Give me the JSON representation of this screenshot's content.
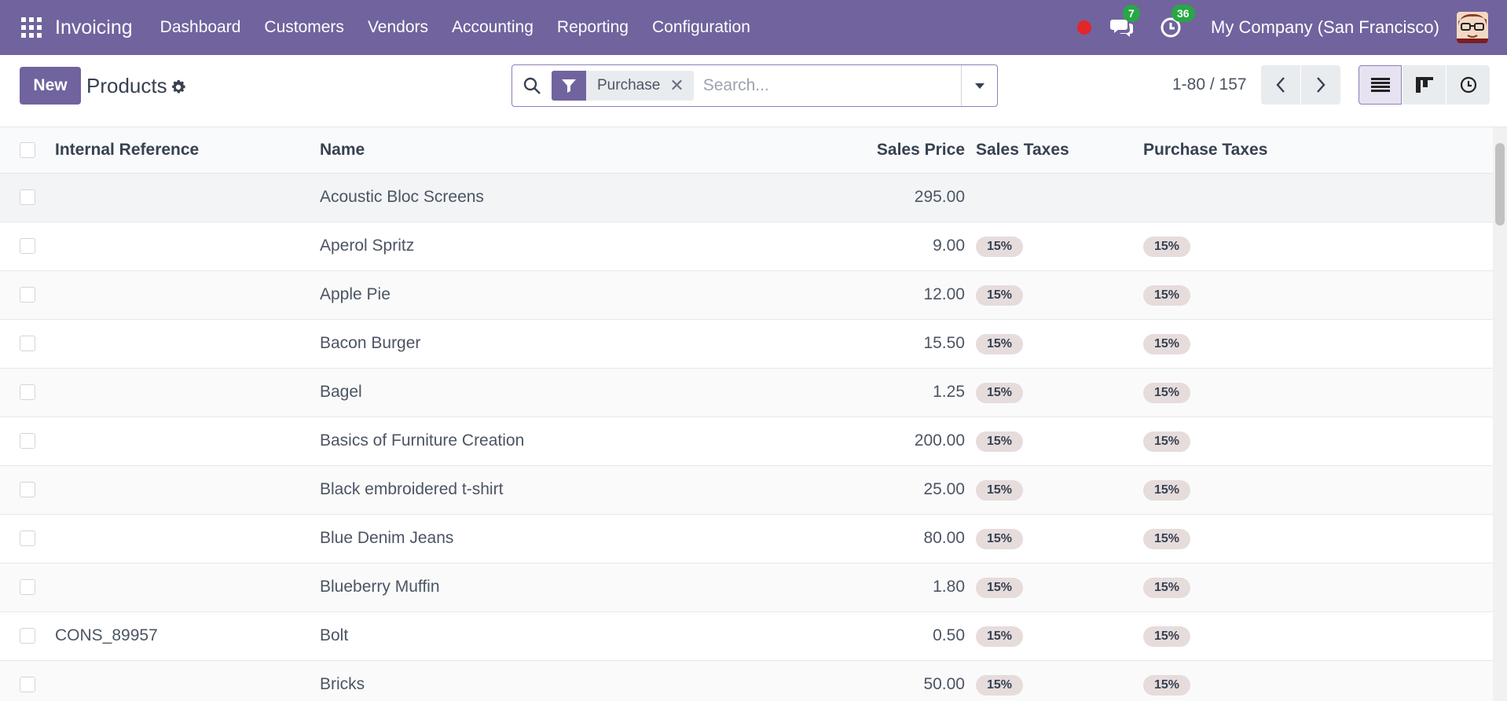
{
  "navbar": {
    "app_name": "Invoicing",
    "menu": [
      "Dashboard",
      "Customers",
      "Vendors",
      "Accounting",
      "Reporting",
      "Configuration"
    ],
    "messages_count": "7",
    "activities_count": "36",
    "company": "My Company (San Francisco)",
    "accent_color": "#71639e"
  },
  "control": {
    "new_label": "New",
    "title": "Products",
    "facet_label": "Purchase",
    "facet_remove": "✕",
    "search_placeholder": "Search...",
    "pager": "1-80 / 157"
  },
  "table": {
    "headers": {
      "ref": "Internal Reference",
      "name": "Name",
      "price": "Sales Price",
      "sales_taxes": "Sales Taxes",
      "purchase_taxes": "Purchase Taxes"
    },
    "rows": [
      {
        "ref": "",
        "name": "Acoustic Bloc Screens",
        "price": "295.00",
        "sales_tax": "",
        "purchase_tax": ""
      },
      {
        "ref": "",
        "name": "Aperol Spritz",
        "price": "9.00",
        "sales_tax": "15%",
        "purchase_tax": "15%"
      },
      {
        "ref": "",
        "name": "Apple Pie",
        "price": "12.00",
        "sales_tax": "15%",
        "purchase_tax": "15%"
      },
      {
        "ref": "",
        "name": "Bacon Burger",
        "price": "15.50",
        "sales_tax": "15%",
        "purchase_tax": "15%"
      },
      {
        "ref": "",
        "name": "Bagel",
        "price": "1.25",
        "sales_tax": "15%",
        "purchase_tax": "15%"
      },
      {
        "ref": "",
        "name": "Basics of Furniture Creation",
        "price": "200.00",
        "sales_tax": "15%",
        "purchase_tax": "15%"
      },
      {
        "ref": "",
        "name": "Black embroidered t-shirt",
        "price": "25.00",
        "sales_tax": "15%",
        "purchase_tax": "15%"
      },
      {
        "ref": "",
        "name": "Blue Denim Jeans",
        "price": "80.00",
        "sales_tax": "15%",
        "purchase_tax": "15%"
      },
      {
        "ref": "",
        "name": "Blueberry Muffin",
        "price": "1.80",
        "sales_tax": "15%",
        "purchase_tax": "15%"
      },
      {
        "ref": "CONS_89957",
        "name": "Bolt",
        "price": "0.50",
        "sales_tax": "15%",
        "purchase_tax": "15%"
      },
      {
        "ref": "",
        "name": "Bricks",
        "price": "50.00",
        "sales_tax": "15%",
        "purchase_tax": "15%"
      }
    ]
  }
}
